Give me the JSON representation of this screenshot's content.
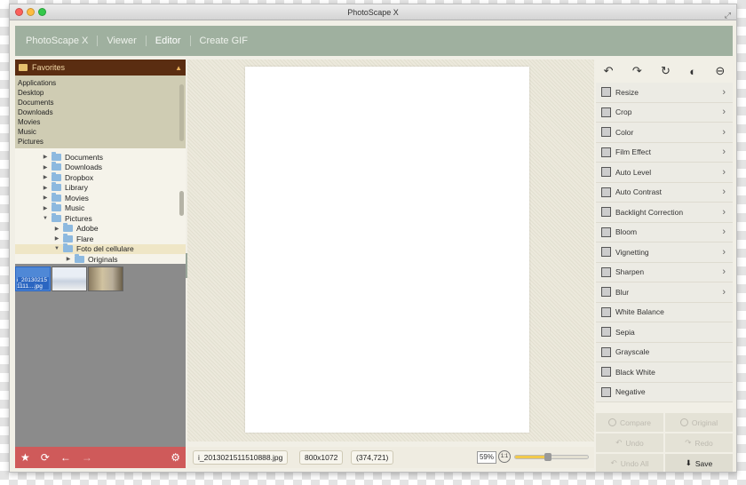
{
  "window": {
    "title": "PhotoScape X"
  },
  "nav": {
    "items": [
      "PhotoScape X",
      "Viewer",
      "Editor",
      "Create GIF"
    ],
    "active": "Editor"
  },
  "favorites": {
    "title": "Favorites",
    "items": [
      "Applications",
      "Desktop",
      "Documents",
      "Downloads",
      "Movies",
      "Music",
      "Pictures"
    ]
  },
  "tree": {
    "items": [
      {
        "label": "Documents",
        "indent": 1,
        "arrow": "right",
        "selected": false
      },
      {
        "label": "Downloads",
        "indent": 1,
        "arrow": "right",
        "selected": false
      },
      {
        "label": "Dropbox",
        "indent": 1,
        "arrow": "right",
        "selected": false
      },
      {
        "label": "Library",
        "indent": 1,
        "arrow": "right",
        "selected": false
      },
      {
        "label": "Movies",
        "indent": 1,
        "arrow": "right",
        "selected": false
      },
      {
        "label": "Music",
        "indent": 1,
        "arrow": "right",
        "selected": false
      },
      {
        "label": "Pictures",
        "indent": 1,
        "arrow": "down",
        "selected": false
      },
      {
        "label": "Adobe",
        "indent": 2,
        "arrow": "right",
        "selected": false
      },
      {
        "label": "Flare",
        "indent": 2,
        "arrow": "right",
        "selected": false
      },
      {
        "label": "Foto del cellulare",
        "indent": 2,
        "arrow": "down",
        "selected": true
      },
      {
        "label": "Originals",
        "indent": 3,
        "arrow": "right",
        "selected": false
      }
    ]
  },
  "thumbs": {
    "first_caption": "i_20130215 1111....jpg"
  },
  "status": {
    "filename": "i_2013021511510888.jpg",
    "dimensions": "800x1072",
    "coords": "(374,721)",
    "zoom": "59%",
    "zoom_level": 0.45
  },
  "tools": [
    {
      "label": "Resize",
      "icon": "resize-icon",
      "chevron": true
    },
    {
      "label": "Crop",
      "icon": "crop-icon",
      "chevron": true
    },
    {
      "label": "Color",
      "icon": "color-icon",
      "chevron": true
    },
    {
      "label": "Film Effect",
      "icon": "film-effect-icon",
      "chevron": true
    },
    {
      "label": "Auto Level",
      "icon": "auto-level-icon",
      "chevron": true
    },
    {
      "label": "Auto Contrast",
      "icon": "auto-contrast-icon",
      "chevron": true
    },
    {
      "label": "Backlight Correction",
      "icon": "backlight-icon",
      "chevron": true
    },
    {
      "label": "Bloom",
      "icon": "bloom-icon",
      "chevron": true
    },
    {
      "label": "Vignetting",
      "icon": "vignetting-icon",
      "chevron": true
    },
    {
      "label": "Sharpen",
      "icon": "sharpen-icon",
      "chevron": true
    },
    {
      "label": "Blur",
      "icon": "blur-icon",
      "chevron": true
    },
    {
      "label": "White Balance",
      "icon": "white-balance-icon",
      "chevron": false
    },
    {
      "label": "Sepia",
      "icon": "sepia-icon",
      "chevron": false
    },
    {
      "label": "Grayscale",
      "icon": "grayscale-icon",
      "chevron": false
    },
    {
      "label": "Black  White",
      "icon": "black-white-icon",
      "chevron": false
    },
    {
      "label": "Negative",
      "icon": "negative-icon",
      "chevron": false
    }
  ],
  "actions": {
    "compare": "Compare",
    "original": "Original",
    "undo": "Undo",
    "redo": "Redo",
    "undo_all": "Undo All",
    "save": "Save"
  },
  "colors": {
    "navbar": "#9fb09f",
    "favorites_header": "#5a2d11",
    "left_bottom": "#cf5a5a"
  }
}
